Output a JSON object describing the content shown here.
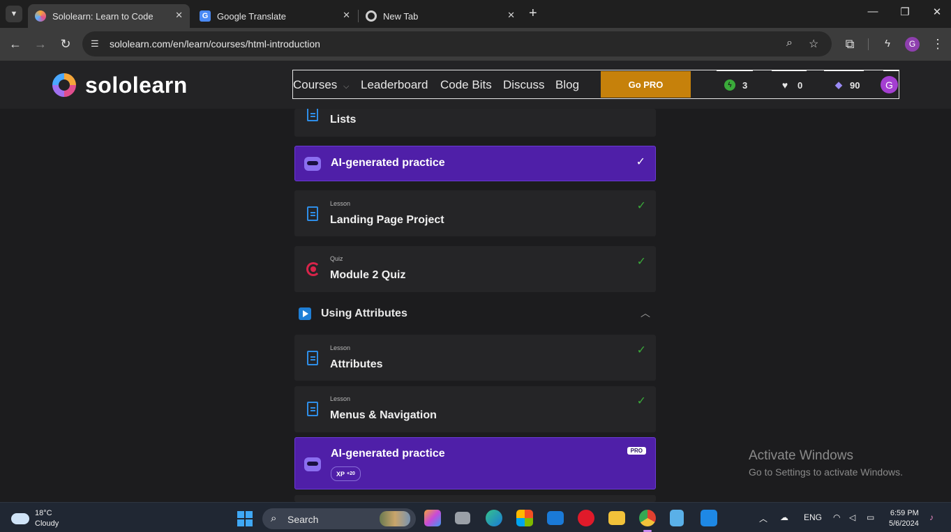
{
  "browser": {
    "tabs": [
      {
        "title": "Sololearn: Learn to Code",
        "favicon": "sololearn-icon",
        "active": true
      },
      {
        "title": "Google Translate",
        "favicon": "google-translate-icon",
        "active": false
      },
      {
        "title": "New Tab",
        "favicon": "chrome-icon",
        "active": false
      }
    ],
    "url": "sololearn.com/en/learn/courses/html-introduction",
    "profile_initial": "G"
  },
  "site": {
    "logo_text": "sololearn",
    "nav": {
      "courses": "Courses",
      "leaderboard": "Leaderboard",
      "code_bits": "Code Bits",
      "discuss": "Discuss",
      "blog": "Blog",
      "go_pro": "Go PRO"
    },
    "stats": {
      "streak": "3",
      "hearts": "0",
      "bits": "90"
    },
    "avatar_initial": "G"
  },
  "content": {
    "items": [
      {
        "title": "Lists"
      },
      {
        "title": "AI-generated practice"
      },
      {
        "kind": "Lesson",
        "title": "Landing Page Project"
      },
      {
        "kind": "Quiz",
        "title": "Module 2 Quiz"
      },
      {
        "module": "Using Attributes"
      },
      {
        "kind": "Lesson",
        "title": "Attributes"
      },
      {
        "kind": "Lesson",
        "title": "Menus & Navigation"
      },
      {
        "title": "AI-generated practice",
        "badge": "PRO",
        "xp_label": "XP",
        "xp_value": "+20"
      }
    ]
  },
  "watermark": {
    "line1": "Activate Windows",
    "line2": "Go to Settings to activate Windows."
  },
  "taskbar": {
    "weather_temp": "18°C",
    "weather_desc": "Cloudy",
    "search_label": "Search",
    "language": "ENG",
    "time": "6:59 PM",
    "date": "5/6/2024"
  },
  "colors": {
    "accent_orange": "#c6810b",
    "practice_purple": "#4f1fa8",
    "check_green": "#3aaa3a",
    "lesson_blue": "#2e8ee8",
    "quiz_red": "#d8244a"
  }
}
